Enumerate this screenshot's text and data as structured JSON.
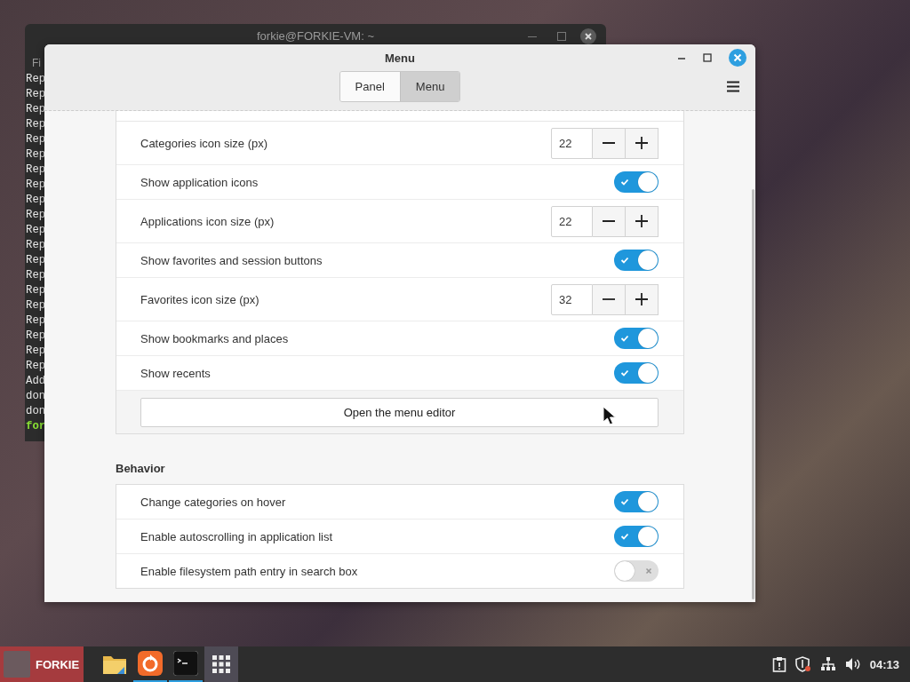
{
  "background_window": {
    "title": "forkie@FORKIE-VM: ~",
    "menu_fragment": "Fi",
    "lines": [
      {
        "text": "Rep",
        "kind": "output"
      },
      {
        "text": "Rep",
        "kind": "output"
      },
      {
        "text": "Rep",
        "kind": "output"
      },
      {
        "text": "Rep",
        "kind": "output"
      },
      {
        "text": "Rep",
        "kind": "output"
      },
      {
        "text": "Rep",
        "kind": "output"
      },
      {
        "text": "Rep",
        "kind": "output"
      },
      {
        "text": "Rep",
        "kind": "output"
      },
      {
        "text": "Rep",
        "kind": "output"
      },
      {
        "text": "Rep",
        "kind": "output"
      },
      {
        "text": "Rep",
        "kind": "output"
      },
      {
        "text": "Rep",
        "kind": "output"
      },
      {
        "text": "Rep",
        "kind": "output"
      },
      {
        "text": "Rep",
        "kind": "output"
      },
      {
        "text": "Rep",
        "kind": "output"
      },
      {
        "text": "Rep",
        "kind": "output"
      },
      {
        "text": "Rep",
        "kind": "output"
      },
      {
        "text": "Rep",
        "kind": "output"
      },
      {
        "text": "Rep",
        "kind": "output"
      },
      {
        "text": "Rep",
        "kind": "output"
      },
      {
        "text": "Add",
        "kind": "output"
      },
      {
        "text": "don",
        "kind": "output"
      },
      {
        "text": "don",
        "kind": "output"
      },
      {
        "text": "for",
        "kind": "prompt"
      }
    ]
  },
  "window": {
    "title": "Menu"
  },
  "tabs": [
    {
      "label": "Panel",
      "selected": false
    },
    {
      "label": "Menu",
      "selected": true
    }
  ],
  "appearance_rows": [
    {
      "kind": "spin",
      "label": "Categories icon size (px)",
      "value": "22"
    },
    {
      "kind": "toggle",
      "label": "Show application icons",
      "on": true
    },
    {
      "kind": "spin",
      "label": "Applications icon size (px)",
      "value": "22"
    },
    {
      "kind": "toggle",
      "label": "Show favorites and session buttons",
      "on": true
    },
    {
      "kind": "spin",
      "label": "Favorites icon size (px)",
      "value": "32"
    },
    {
      "kind": "toggle",
      "label": "Show bookmarks and places",
      "on": true
    },
    {
      "kind": "toggle",
      "label": "Show recents",
      "on": true
    },
    {
      "kind": "button",
      "label": "Open the menu editor"
    }
  ],
  "behavior": {
    "heading": "Behavior",
    "rows": [
      {
        "kind": "toggle",
        "label": "Change categories on hover",
        "on": true
      },
      {
        "kind": "toggle",
        "label": "Enable autoscrolling in application list",
        "on": true
      },
      {
        "kind": "toggle",
        "label": "Enable filesystem path entry in search box",
        "on": false
      }
    ]
  },
  "taskbar": {
    "menu_label": "FORKIE",
    "apps": [
      {
        "kind": "folder",
        "running": false,
        "active": false
      },
      {
        "kind": "browser",
        "running": true,
        "active": false
      },
      {
        "kind": "terminal",
        "running": true,
        "active": false
      },
      {
        "kind": "grid",
        "running": false,
        "active": true
      }
    ],
    "clock": "04:13"
  }
}
